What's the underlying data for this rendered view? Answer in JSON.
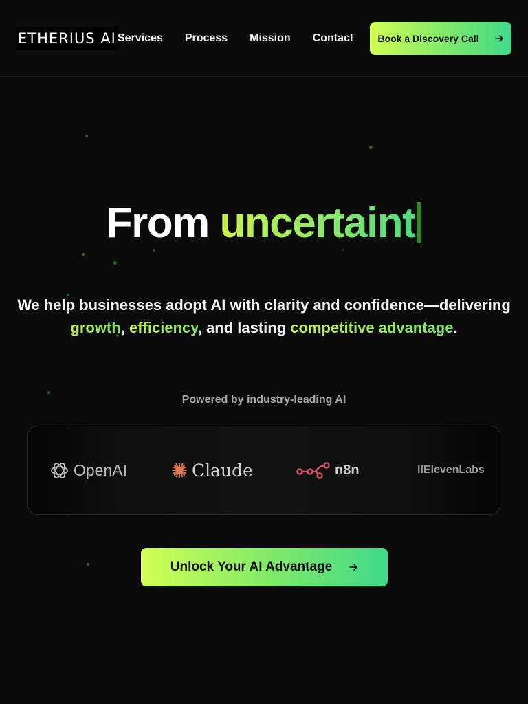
{
  "brand": {
    "logo_text": "ETHERIUS AI",
    "accent_color": "#c8f24a",
    "accent_color_end": "#3fd98a"
  },
  "nav": {
    "items": [
      {
        "label": "Services"
      },
      {
        "label": "Process"
      },
      {
        "label": "Mission"
      },
      {
        "label": "Contact"
      }
    ],
    "cta_label": "Book a Discovery Call",
    "cta_icon": "arrow-right-icon"
  },
  "hero": {
    "headline_static": "From",
    "headline_typed": "uncertaint",
    "subtitle": {
      "part1": "We help businesses adopt AI with clarity and confidence—delivering",
      "hl1": "growth",
      "sep1": ",",
      "hl2": "efficiency",
      "part2": ", and lasting",
      "hl3": "competitive advantage",
      "end": "."
    },
    "cta_label": "Unlock Your AI Advantage",
    "cta_icon": "arrow-right-icon"
  },
  "partners": {
    "heading": "Powered by industry-leading AI",
    "items": [
      {
        "name": "OpenAI",
        "icon": "openai-logo-icon"
      },
      {
        "name": "Claude",
        "icon": "claude-starburst-icon"
      },
      {
        "name": "n8n",
        "icon": "n8n-nodes-icon"
      },
      {
        "name": "IIElevenLabs",
        "icon": "elevenlabs-logo-icon"
      }
    ]
  }
}
